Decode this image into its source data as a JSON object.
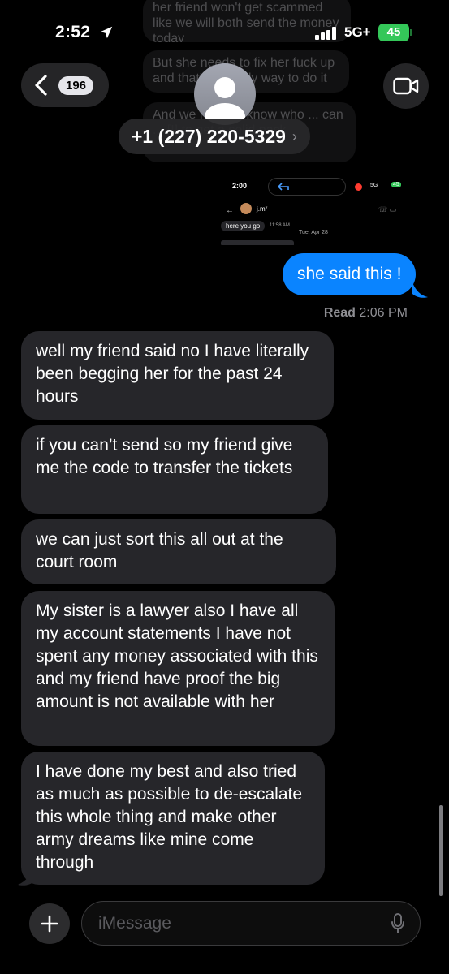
{
  "status_bar": {
    "time": "2:52",
    "network": "5G+",
    "battery": "45"
  },
  "faded_messages": [
    "her friend won't get scammed like we will both send the money today",
    "But she needs to fix her fuck up and that's the only way to do it",
    "And we need to know who ... can ... [I] to get a solid pack"
  ],
  "header": {
    "back_count": "196",
    "contact": "+1 (227) 220-5329",
    "chevron": "›"
  },
  "attachment": {
    "time": "2:00",
    "net": "5G",
    "battery": "45",
    "contact": "j.m⁷",
    "message": "here you go",
    "timestamp": "11:58 AM",
    "date": "Tue, Apr 28"
  },
  "sent_message": "she said this !",
  "read_receipt": {
    "label": "Read",
    "time": "2:06 PM"
  },
  "received_messages": [
    "well my friend said no I have literally been begging her for the past 24 hours",
    "if you can’t send so my friend give me the code to transfer the tickets",
    "we can just sort this all out at the court room",
    "My sister is a lawyer also I have all my account statements I have not spent any money associated with this and my friend have proof the big amount is not available with her",
    "I have done my best and also tried as much as possible to de-escalate this whole thing and make other army dreams like mine come through"
  ],
  "input": {
    "placeholder": "iMessage"
  },
  "colors": {
    "sent_bubble": "#0a84ff",
    "received_bubble": "#26262a",
    "battery": "#34c759"
  }
}
